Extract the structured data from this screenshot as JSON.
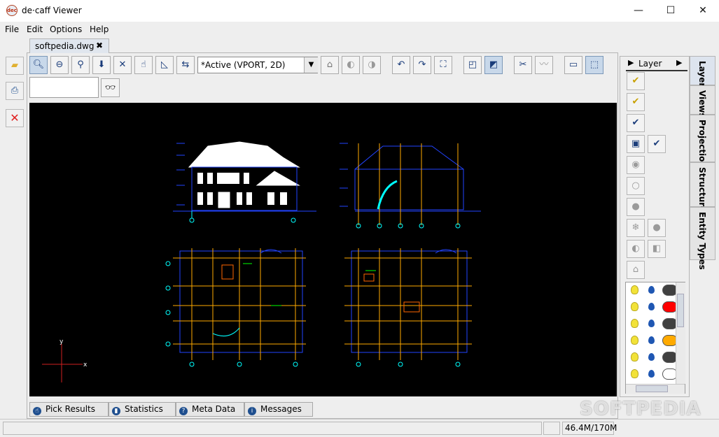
{
  "window": {
    "title": "de·caff Viewer",
    "app_icon_text": "dec",
    "minimize": "—",
    "maximize": "☐",
    "close": "✕"
  },
  "menu": [
    "File",
    "Edit",
    "Options",
    "Help"
  ],
  "document_tab": {
    "label": "softpedia.dwg",
    "close": "✖"
  },
  "view_combo": {
    "value": "*Active (VPORT, 2D)",
    "arrow": "▼"
  },
  "search": {
    "value": "",
    "find_icon": "binoculars-icon"
  },
  "bottom_tabs": [
    {
      "label": "Pick Results",
      "icon": "pointer-hand-icon"
    },
    {
      "label": "Statistics",
      "icon": "bar-chart-icon"
    },
    {
      "label": "Meta Data",
      "icon": "help-icon"
    },
    {
      "label": "Messages",
      "icon": "info-icon"
    }
  ],
  "status": {
    "memory": "46.4M/170M"
  },
  "layer_panel": {
    "title": "Layer",
    "left_arrow": "▶",
    "right_arrow": "▶"
  },
  "side_tabs": [
    "Layer",
    "Views",
    "Projection",
    "Structure",
    "Entity Types"
  ],
  "layer_colors": [
    "#404040",
    "#ff0000",
    "#404040",
    "#ffaa00",
    "#404040",
    "#ffffff"
  ],
  "canvas": {
    "background": "#000000",
    "axis_x": "x",
    "axis_y": "y"
  },
  "watermark": "SOFTPEDIA"
}
